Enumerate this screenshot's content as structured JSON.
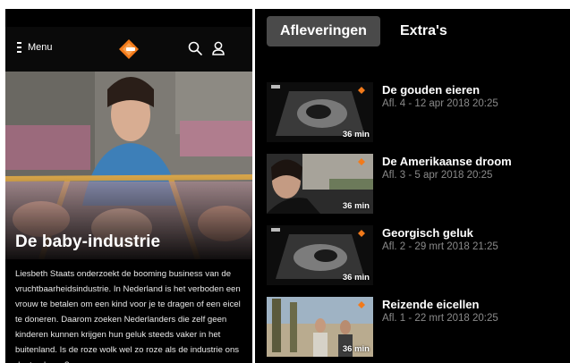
{
  "left": {
    "menu_label": "Menu",
    "logo_text": "NPO START",
    "hero_title": "De baby-industrie",
    "hero_description": "Liesbeth Staats onderzoekt de booming business van de vruchtbaarheidsindustrie. In Nederland is het verboden een vrouw te betalen om een kind voor je te dragen of een eicel te doneren. Daarom zoeken Nederlanders die zelf geen kinderen kunnen krijgen hun geluk steeds vaker in het buitenland. Is de roze wolk wel zo roze als de industrie ons doet geloven?",
    "icons": {
      "menu": "hamburger-icon",
      "logo": "npo-start-logo",
      "search": "search-icon",
      "account": "user-icon"
    }
  },
  "right": {
    "tabs": [
      {
        "label": "Afleveringen",
        "active": true
      },
      {
        "label": "Extra's",
        "active": false
      }
    ],
    "episodes": [
      {
        "title": "De gouden eieren",
        "meta": "Afl. 4 - 12 apr 2018 20:25",
        "duration": "36 min",
        "thumb": "ultrasound"
      },
      {
        "title": "De Amerikaanse droom",
        "meta": "Afl. 3 - 5 apr 2018 20:25",
        "duration": "36 min",
        "thumb": "car"
      },
      {
        "title": "Georgisch geluk",
        "meta": "Afl. 2 - 29 mrt 2018 21:25",
        "duration": "36 min",
        "thumb": "ultrasound"
      },
      {
        "title": "Reizende eicellen",
        "meta": "Afl. 1 - 22 mrt 2018 20:25",
        "duration": "36 min",
        "thumb": "street"
      }
    ]
  },
  "colors": {
    "accent_orange": "#f27a1a",
    "background": "#000000",
    "tab_active_bg": "#4a4a4a",
    "meta_gray": "#8a8a8a"
  }
}
